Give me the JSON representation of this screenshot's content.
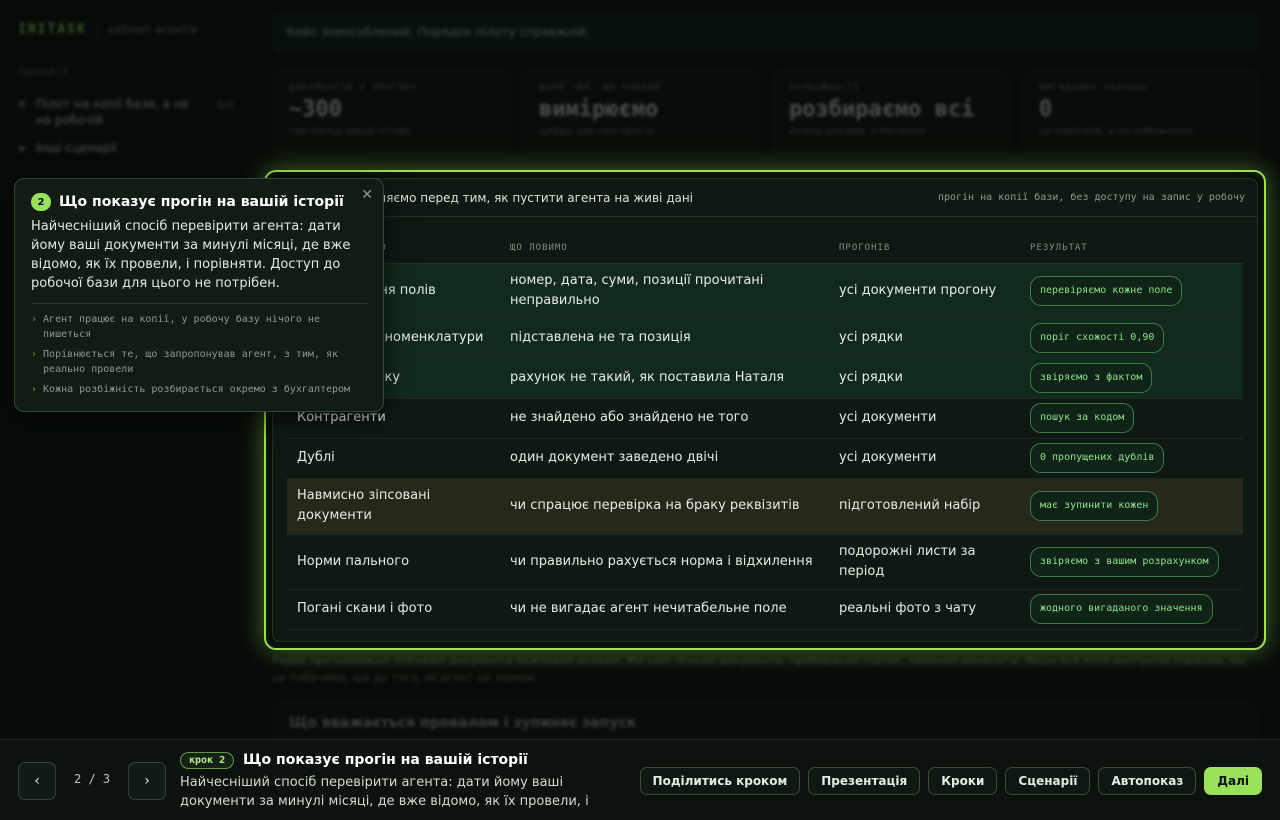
{
  "app": {
    "brand": "INITASK",
    "subtitle": "кабінет агентів"
  },
  "sidebar": {
    "section": "СЦЕНАРІЇ",
    "items": [
      {
        "label": "Пілот на копії бази, а не на робочій",
        "count": "2/3"
      },
      {
        "label": "Інші сценарії"
      }
    ]
  },
  "notice": "Кейс знеособлений. Порядок пілоту справжній.",
  "stats": [
    {
      "label": "ДОКУМЕНТІВ У ПРОГОНІ",
      "value": "~300",
      "sub": "три місяці вашої історії"
    },
    {
      "label": "ДОЛЯ ТИХ, ЩО ПОВЕЛИ",
      "value": "вимірюємо",
      "sub": "цифру дає сам прогін"
    },
    {
      "label": "РОЗБІЖНОСТІ",
      "value": "розбираємо всі",
      "sub": "кожну руками, з Наталею"
    },
    {
      "label": "ВИГАДАНИХ ЗНАЧЕНЬ",
      "value": "0",
      "sub": "це критерій, а не побажання"
    }
  ],
  "table_card": {
    "title": "Що ми проганяємо перед тим, як пустити агента на живі дані",
    "note": "прогін на копії бази, без доступу на запис у робочу",
    "columns": [
      "ЩО ПЕРЕВІРЯЄМО",
      "ЩО ЛОВИМО",
      "ПРОГОНІВ",
      "РЕЗУЛЬТАТ"
    ],
    "rows": [
      {
        "check": "Розпізнавання полів",
        "catch": "номер, дата, суми, позиції прочитані неправильно",
        "runs": "усі документи прогону",
        "result": "перевіряємо кожне поле"
      },
      {
        "check": "Зіставлення номенклатури",
        "catch": "підставлена не та позиція",
        "runs": "усі рядки",
        "result": "поріг схожості 0,90"
      },
      {
        "check": "Рахунок обліку",
        "catch": "рахунок не такий, як поставила Наталя",
        "runs": "усі рядки",
        "result": "звіряємо з фактом"
      },
      {
        "check": "Контрагенти",
        "catch": "не знайдено або знайдено не того",
        "runs": "усі документи",
        "result": "пошук за кодом"
      },
      {
        "check": "Дублі",
        "catch": "один документ заведено двічі",
        "runs": "усі документи",
        "result": "0 пропущених дублів"
      },
      {
        "check": "Навмисно зіпсовані документи",
        "catch": "чи спрацює перевірка на браку реквізитів",
        "runs": "підготовлений набір",
        "result": "має зупинити кожен"
      },
      {
        "check": "Норми пального",
        "catch": "чи правильно рахується норма і відхилення",
        "runs": "подорожні листи за період",
        "result": "звіряємо з вашим розрахунком"
      },
      {
        "check": "Погані скани і фото",
        "catch": "чи не вигадає агент нечитабельне поле",
        "runs": "реальні фото з чату",
        "result": "жодного вигаданого значення"
      }
    ]
  },
  "below": {
    "caption": "Рядок про навмисно зіпсовані документи важливий окремо. Ми самі псуємо документи: прибираємо підпис, ламаємо реквізити. Якщо вся лінія контролю спрацює, ми це побачимо, ще до того, як агент це зламає.",
    "next_card_title": "Що вважається провалом і зупиняє запуск"
  },
  "popover": {
    "number": "2",
    "title": "Що показує прогін на вашій історії",
    "close": "✕",
    "body": "Найчесніший спосіб перевірити агента: дати йому ваші документи за минулі місяці, де вже відомо, як їх провели, і порівняти. Доступ до робочої бази для цього не потрібен.",
    "bullets": [
      "Агент працює на копії, у робочу базу нічого не пишеться",
      "Порівнюється те, що запропонував агент, з тим, як реально провели",
      "Кожна розбіжність розбирається окремо з бухгалтером"
    ]
  },
  "bottom": {
    "prev": "‹",
    "next": "›",
    "page": "2 / 3",
    "step_badge": "крок 2",
    "title": "Що показує прогін на вашій історії",
    "desc": "Найчесніший спосіб перевірити агента: дати йому ваші документи за минулі місяці, де вже відомо, як їх провели, і порівняти. Досту…",
    "actions": [
      "Поділитись кроком",
      "Презентація",
      "Кроки",
      "Сценарії",
      "Автопоказ"
    ],
    "primary": "Далі"
  },
  "colors": {
    "accent": "#9be05c",
    "bg": "#0b120d",
    "pill_text": "#8fe08a"
  }
}
